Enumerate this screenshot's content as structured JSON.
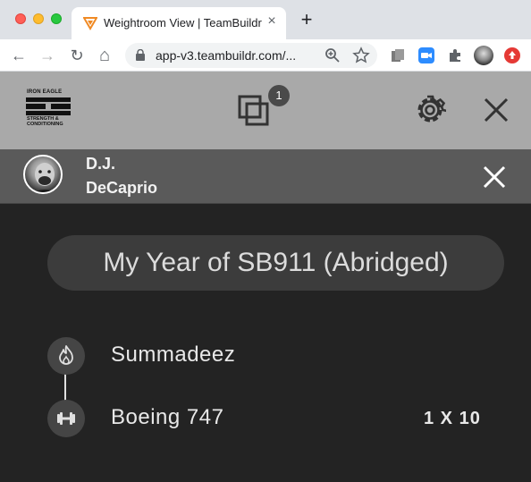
{
  "browser": {
    "tab_title": "Weightroom View | TeamBuildr",
    "tab_close": "×",
    "new_tab": "+",
    "url": "app-v3.teambuildr.com/...",
    "nav": {
      "back": "←",
      "forward": "→",
      "reload": "↻",
      "home": "⌂"
    }
  },
  "header": {
    "logo_top": "IRON EAGLE",
    "logo_bottom_1": "STRENGTH &",
    "logo_bottom_2": "CONDITIONING",
    "badge_count": "1"
  },
  "user": {
    "first_name": "D.J.",
    "last_name": "DeCaprio"
  },
  "workout": {
    "title": "My Year of SB911 (Abridged)",
    "items": [
      {
        "label": "Summadeez",
        "icon": "flame-icon"
      },
      {
        "label": "Boeing 747",
        "icon": "dumbbell-icon",
        "sets": "1 X 10"
      }
    ]
  },
  "colors": {
    "header_bg": "#a9a9a9",
    "userbar_bg": "#5a5a5a",
    "main_bg": "#232323",
    "pill_bg": "#3c3c3c"
  }
}
